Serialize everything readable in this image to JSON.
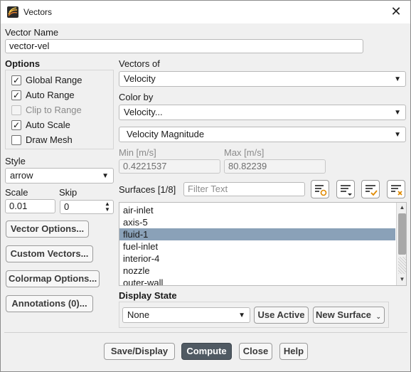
{
  "window": {
    "title": "Vectors"
  },
  "vector_name": {
    "label": "Vector Name",
    "value": "vector-vel"
  },
  "options": {
    "label": "Options",
    "items": [
      {
        "label": "Global Range",
        "checked": true,
        "enabled": true
      },
      {
        "label": "Auto Range",
        "checked": true,
        "enabled": true
      },
      {
        "label": "Clip to Range",
        "checked": false,
        "enabled": false
      },
      {
        "label": "Auto Scale",
        "checked": true,
        "enabled": true
      },
      {
        "label": "Draw Mesh",
        "checked": false,
        "enabled": true
      }
    ]
  },
  "style": {
    "label": "Style",
    "value": "arrow"
  },
  "scale": {
    "label": "Scale",
    "value": "0.01"
  },
  "skip": {
    "label": "Skip",
    "value": "0"
  },
  "side_buttons": {
    "vector_options": "Vector Options...",
    "custom_vectors": "Custom Vectors...",
    "colormap_options": "Colormap Options...",
    "annotations": "Annotations (0)..."
  },
  "vectors_of": {
    "label": "Vectors of",
    "value": "Velocity"
  },
  "color_by": {
    "label": "Color by",
    "value": "Velocity...",
    "sub_value": "Velocity Magnitude"
  },
  "range": {
    "min_label": "Min [m/s]",
    "min_value": "0.4221537",
    "max_label": "Max [m/s]",
    "max_value": "80.82239"
  },
  "surfaces": {
    "label": "Surfaces [1/8]",
    "filter_placeholder": "Filter Text",
    "items": [
      "air-inlet",
      "axis-5",
      "fluid-1",
      "fuel-inlet",
      "interior-4",
      "nozzle",
      "outer-wall"
    ],
    "selected": "fluid-1"
  },
  "display_state": {
    "label": "Display State",
    "value": "None",
    "use_active": "Use Active",
    "new_surface": "New Surface"
  },
  "footer": {
    "save_display": "Save/Display",
    "compute": "Compute",
    "close": "Close",
    "help": "Help"
  }
}
